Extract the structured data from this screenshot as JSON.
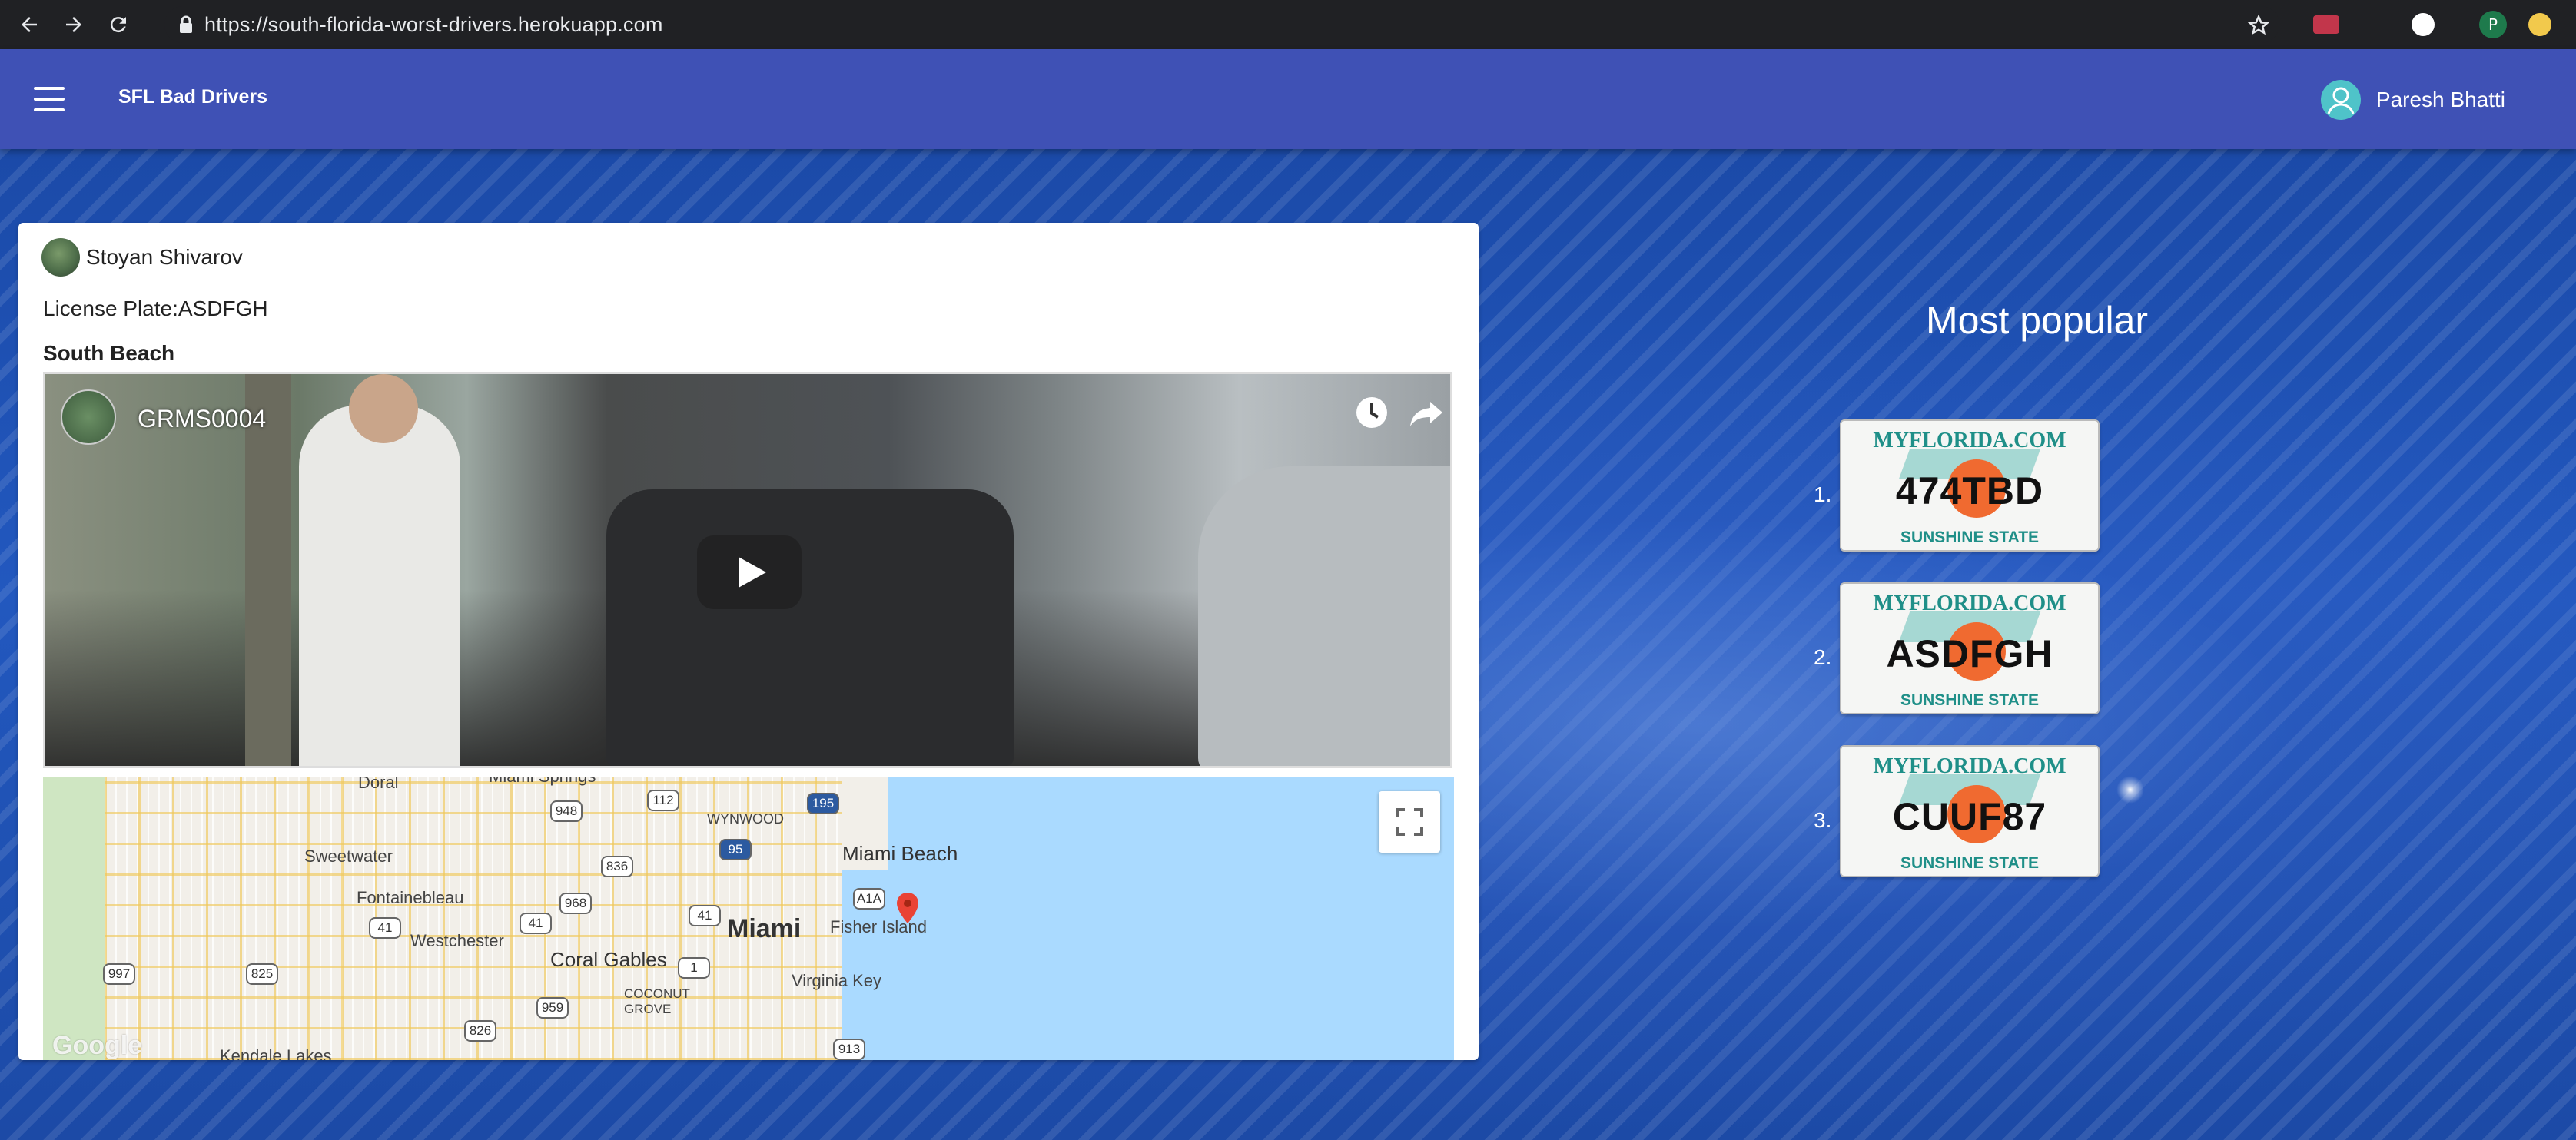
{
  "browser": {
    "url": "https://south-florida-worst-drivers.herokuapp.com",
    "profile_initial": "P"
  },
  "appbar": {
    "brand": "SFL Bad Drivers",
    "user_name": "Paresh Bhatti"
  },
  "post": {
    "author": "Stoyan Shivarov",
    "license_plate_line": "License Plate:ASDFGH",
    "location": "South Beach",
    "video": {
      "title": "GRMS0004"
    },
    "map": {
      "labels": {
        "doral": "Doral",
        "miami_springs": "Miami Springs",
        "wynwood": "WYNWOOD",
        "miami_beach": "Miami Beach",
        "sweetwater": "Sweetwater",
        "fontainebleau": "Fontainebleau",
        "miami": "Miami",
        "fisher_island": "Fisher Island",
        "westchester": "Westchester",
        "coral_gables": "Coral Gables",
        "virginia_key": "Virginia Key",
        "coconut_grove": "COCONUT GROVE",
        "kendale_lakes": "Kendale Lakes",
        "google": "Google"
      },
      "shields": {
        "s112": "112",
        "s195": "195",
        "s948": "948",
        "s95": "95",
        "s836": "836",
        "s968": "968",
        "sA1A": "A1A",
        "s41a": "41",
        "s41b": "41",
        "s41c": "41",
        "s997": "997",
        "s825": "825",
        "s1": "1",
        "s959": "959",
        "s826": "826",
        "s913": "913"
      }
    }
  },
  "popular": {
    "title": "Most popular",
    "items": [
      {
        "rank": "1.",
        "plate": "474TBD",
        "top": "MYFLORIDA.COM",
        "bottom": "SUNSHINE STATE"
      },
      {
        "rank": "2.",
        "plate": "ASDFGH",
        "top": "MYFLORIDA.COM",
        "bottom": "SUNSHINE STATE"
      },
      {
        "rank": "3.",
        "plate": "CUUF87",
        "top": "MYFLORIDA.COM",
        "bottom": "SUNSHINE STATE"
      }
    ]
  },
  "colors": {
    "appbar": "#3f51b5",
    "background": "#1b4aa8",
    "plate_teal": "#1f8f88",
    "plate_orange": "#f06a30"
  }
}
